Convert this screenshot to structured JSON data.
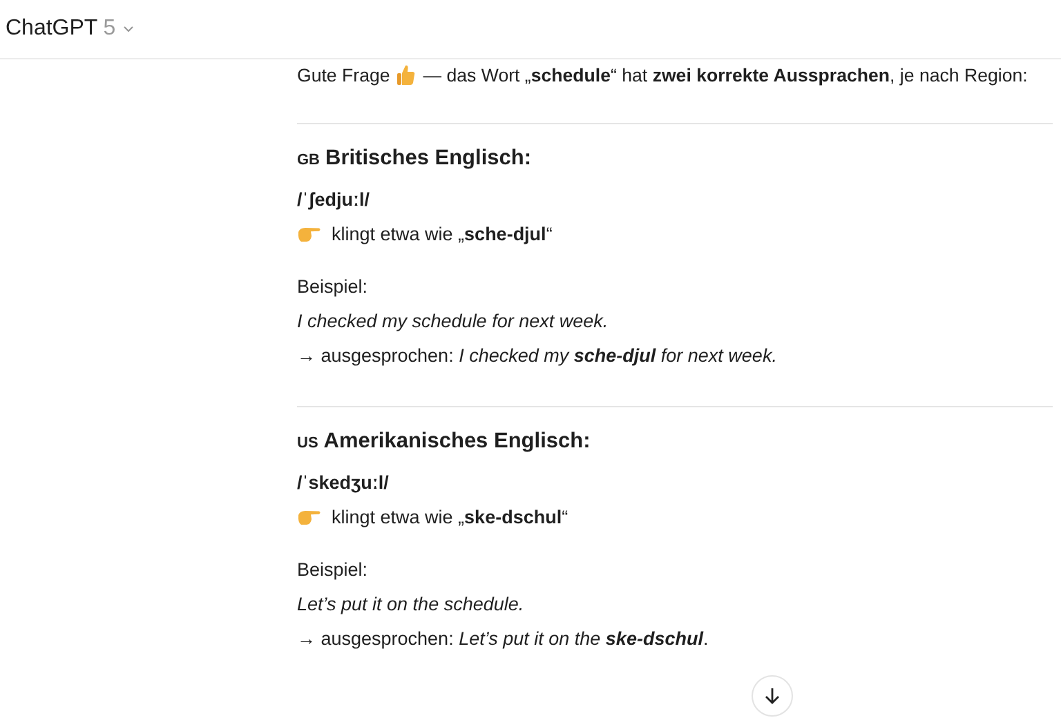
{
  "header": {
    "title": "ChatGPT",
    "version": "5"
  },
  "intro": {
    "lead": "Gute Frage",
    "rest": "— das Wort „**schedule**“ hat **zwei korrekte Aussprachen**, je nach Region:"
  },
  "sections": [
    {
      "flag": "GB",
      "title": "Britisches Englisch:",
      "ipa": "/ˈʃedjuːl/",
      "sounds_like": "klingt etwa wie „**sche-djul**“",
      "example_label": "Beispiel:",
      "example": "I checked my schedule for next week.",
      "spoken": "→ ausgesprochen: *I checked my* **sche-djul** *for next week.*"
    },
    {
      "flag": "US",
      "title": "Amerikanisches Englisch:",
      "ipa": "/ˈskedʒuːl/",
      "sounds_like": "klingt etwa wie „**ske-dschul**“",
      "example_label": "Beispiel:",
      "example": "Let’s put it on the schedule.",
      "spoken": "→ ausgesprochen: *Let’s put it on the* **ske-dschul**."
    }
  ]
}
